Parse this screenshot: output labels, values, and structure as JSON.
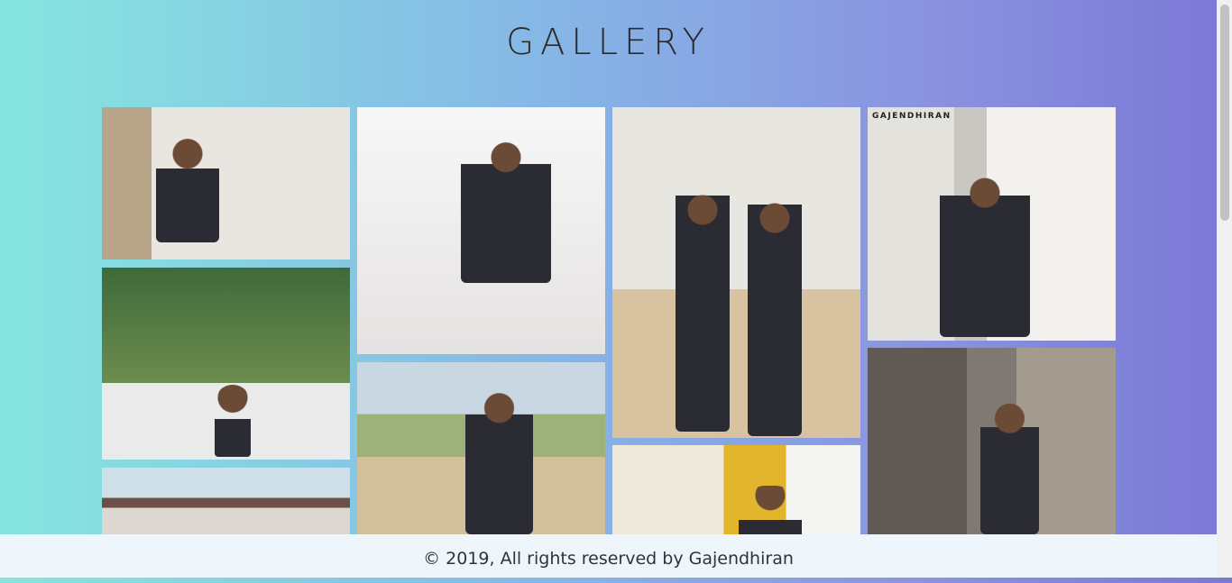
{
  "page": {
    "title": "GALLERY"
  },
  "gallery": {
    "photos": [
      {
        "name": "photo-1",
        "watermark": ""
      },
      {
        "name": "photo-2",
        "watermark": ""
      },
      {
        "name": "photo-3",
        "watermark": ""
      },
      {
        "name": "photo-4",
        "watermark": "GAJENDHIRAN"
      },
      {
        "name": "photo-5",
        "watermark": ""
      },
      {
        "name": "photo-6",
        "watermark": ""
      },
      {
        "name": "photo-7",
        "watermark": ""
      },
      {
        "name": "photo-8",
        "watermark": ""
      },
      {
        "name": "photo-9",
        "watermark": ""
      }
    ]
  },
  "footer": {
    "text": "© 2019, All rights reserved by Gajendhiran"
  }
}
